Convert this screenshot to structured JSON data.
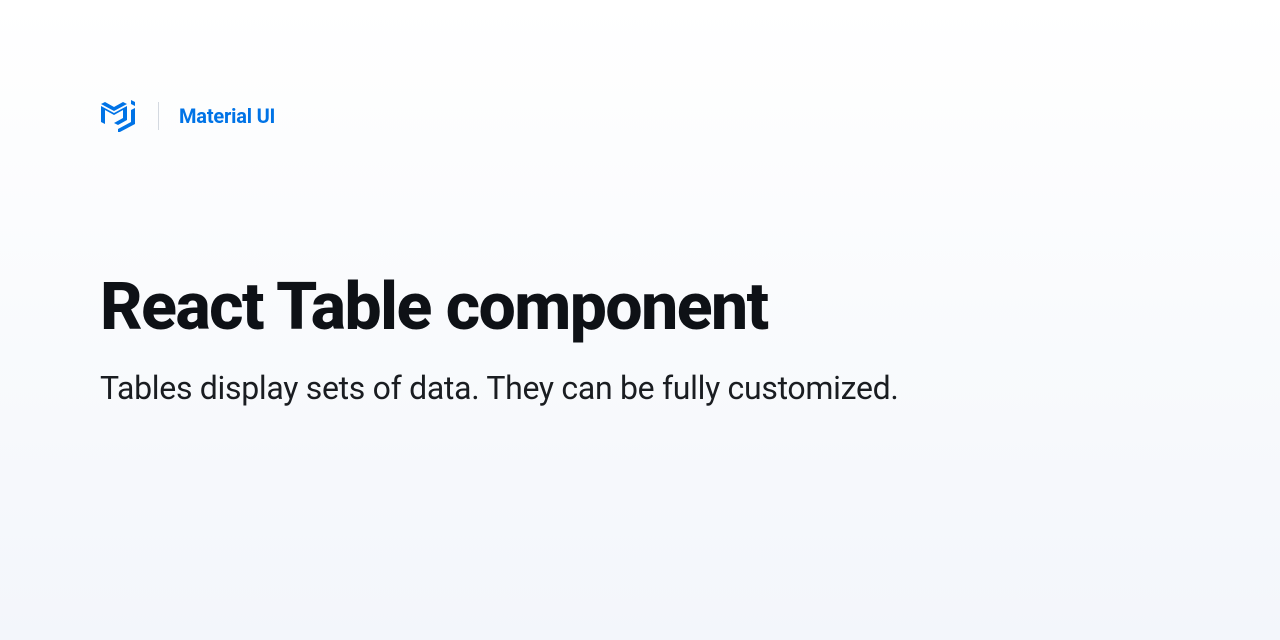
{
  "header": {
    "brand": "Material UI"
  },
  "content": {
    "title": "React Table component",
    "subtitle": "Tables display sets of data. They can be fully customized."
  },
  "colors": {
    "accent": "#0073e6",
    "text_primary": "#0e1116",
    "text_secondary": "#1a1d21"
  }
}
